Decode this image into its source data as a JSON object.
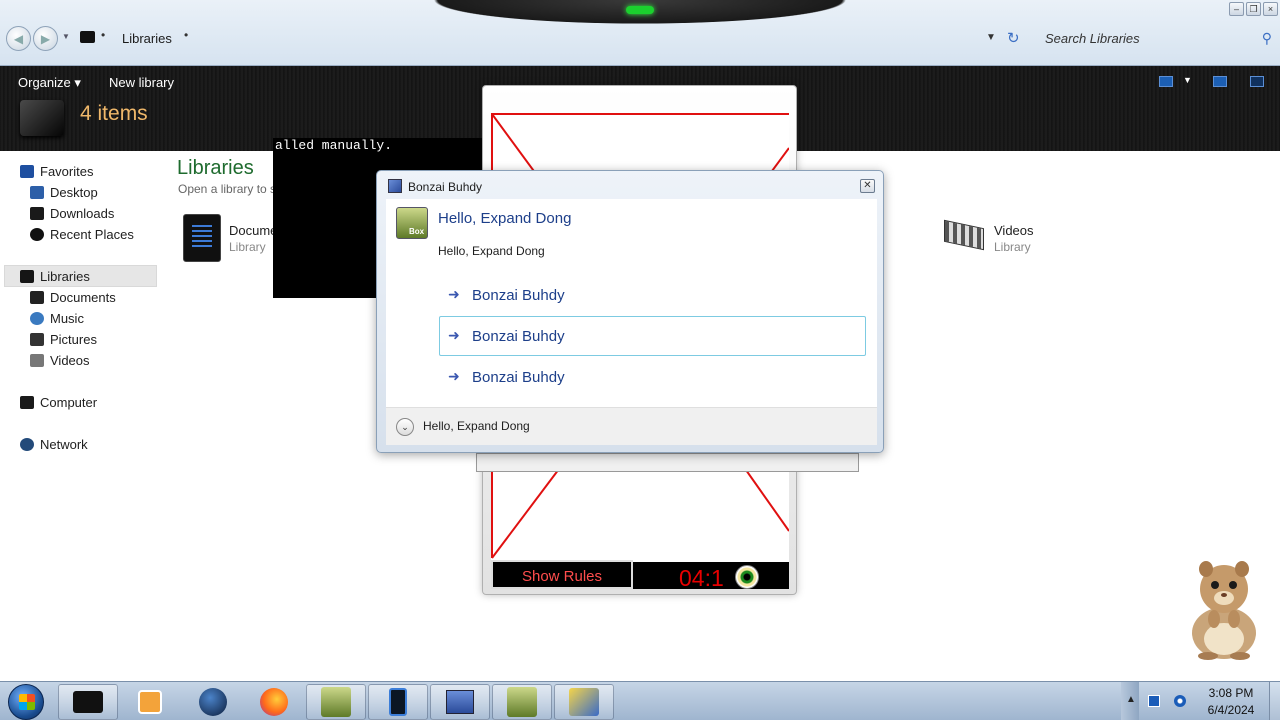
{
  "explorer": {
    "breadcrumb": "Libraries",
    "search_placeholder": "Search Libraries",
    "toolbar": {
      "organize": "Organize",
      "new_library": "New library",
      "items_count": "4 items"
    },
    "nav": {
      "favorites": "Favorites",
      "desktop": "Desktop",
      "downloads": "Downloads",
      "recent_places": "Recent Places",
      "libraries": "Libraries",
      "documents": "Documents",
      "music": "Music",
      "pictures": "Pictures",
      "videos": "Videos",
      "computer": "Computer",
      "network": "Network"
    },
    "content": {
      "title": "Libraries",
      "subtitle": "Open a library to s",
      "tiles": [
        {
          "name": "Docume",
          "kind": "Library"
        },
        {
          "name": "Videos",
          "kind": "Library"
        }
      ]
    }
  },
  "console": {
    "text": "alled manually."
  },
  "game": {
    "show_rules": "Show Rules",
    "timer": "04:1"
  },
  "dialog": {
    "title": "Bonzai Buhdy",
    "avatar_tag": "Box",
    "heading": "Hello, Expand Dong",
    "text": "Hello, Expand Dong",
    "links": [
      "Bonzai Buhdy",
      "Bonzai Buhdy",
      "Bonzai Buhdy"
    ],
    "footer": "Hello, Expand Dong"
  },
  "taskbar": {
    "time": "3:08 PM",
    "date": "6/4/2024",
    "buttons": [
      "explorer",
      "media-player",
      "globe",
      "firefox",
      "bonzi",
      "phone",
      "network",
      "bonzi",
      "check"
    ]
  },
  "colors": {
    "accent_green": "#1e6b2e",
    "items_orange": "#f0b86a",
    "link_blue": "#1d3f8a",
    "timer_red": "#e80000"
  }
}
